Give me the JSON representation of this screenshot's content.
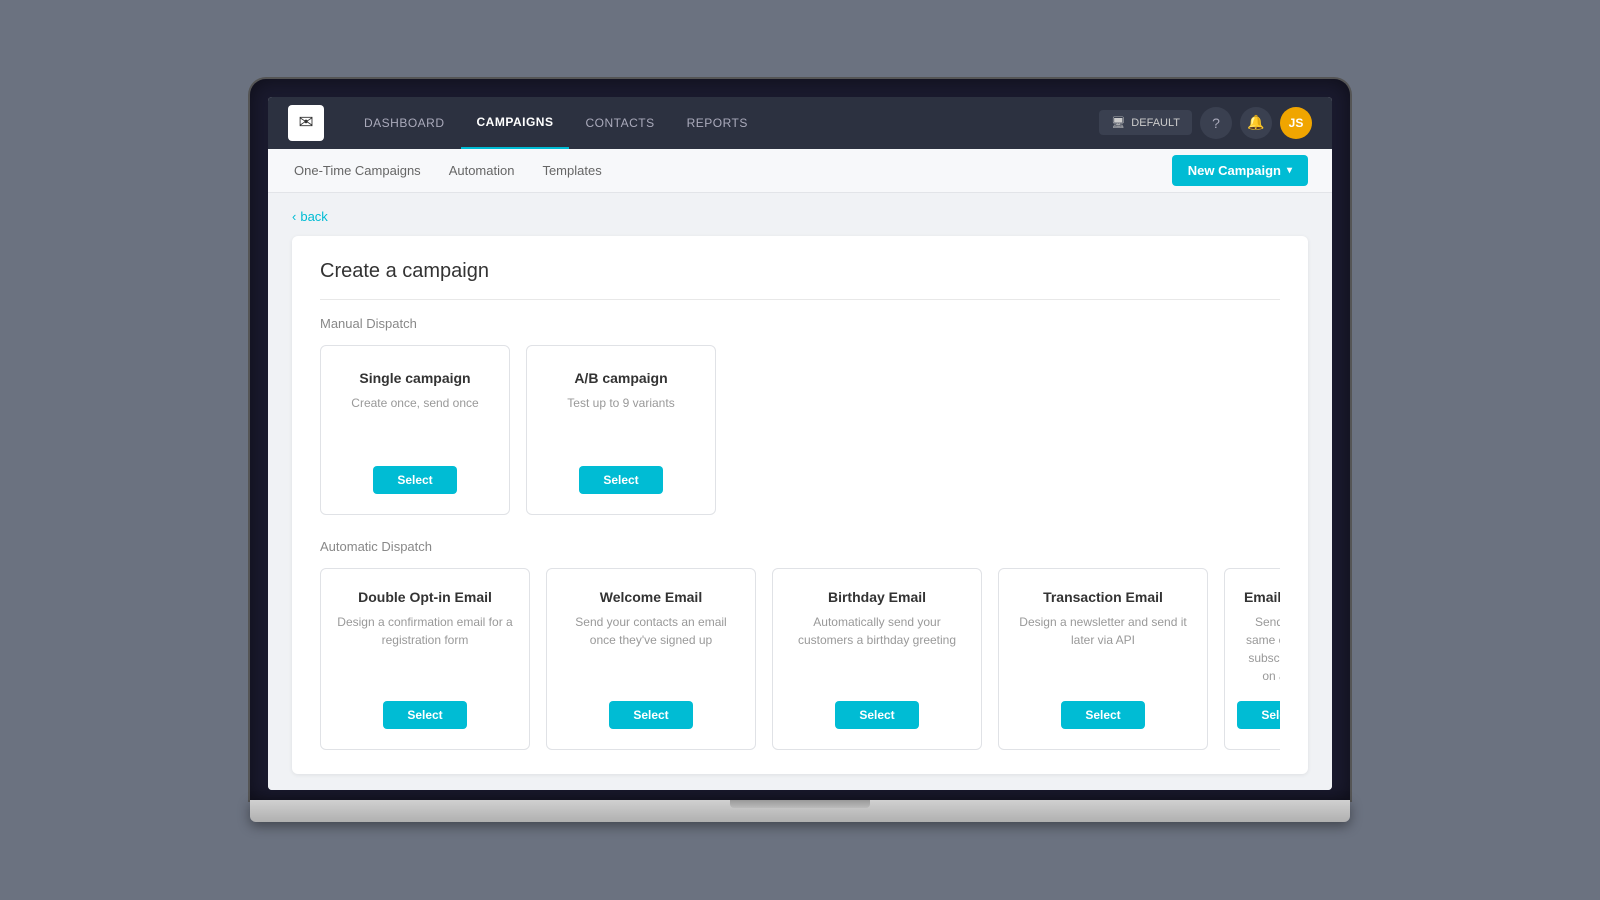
{
  "nav": {
    "logo_symbol": "✉",
    "links": [
      {
        "label": "DASHBOARD",
        "active": false
      },
      {
        "label": "CAMPAIGNS",
        "active": true
      },
      {
        "label": "CONTACTS",
        "active": false
      },
      {
        "label": "REPORTS",
        "active": false
      }
    ],
    "default_btn": "DEFAULT",
    "help_icon": "?",
    "bell_icon": "🔔",
    "avatar_initials": "JS"
  },
  "sub_nav": {
    "links": [
      {
        "label": "One-Time Campaigns",
        "active": false
      },
      {
        "label": "Automation",
        "active": false
      },
      {
        "label": "Templates",
        "active": false
      }
    ],
    "new_campaign_label": "New Campaign",
    "dropdown_arrow": "▾"
  },
  "back_label": "back",
  "create": {
    "title": "Create a campaign",
    "manual_dispatch_label": "Manual Dispatch",
    "manual_cards": [
      {
        "title": "Single campaign",
        "desc": "Create once, send once",
        "btn": "Select"
      },
      {
        "title": "A/B campaign",
        "desc": "Test up to 9 variants",
        "btn": "Select"
      }
    ],
    "automatic_dispatch_label": "Automatic Dispatch",
    "auto_cards": [
      {
        "title": "Double Opt-in Email",
        "desc": "Design a confirmation email for a registration form",
        "btn": "Select"
      },
      {
        "title": "Welcome Email",
        "desc": "Send your contacts an email once they've signed up",
        "btn": "Select"
      },
      {
        "title": "Birthday Email",
        "desc": "Automatically send your customers a birthday greeting",
        "btn": "Select"
      },
      {
        "title": "Transaction Email",
        "desc": "Design a newsletter and send it later via API",
        "btn": "Select"
      },
      {
        "title": "Email Se...",
        "desc": "Send the same ema... subscribers on a...",
        "btn": "Select"
      }
    ]
  }
}
